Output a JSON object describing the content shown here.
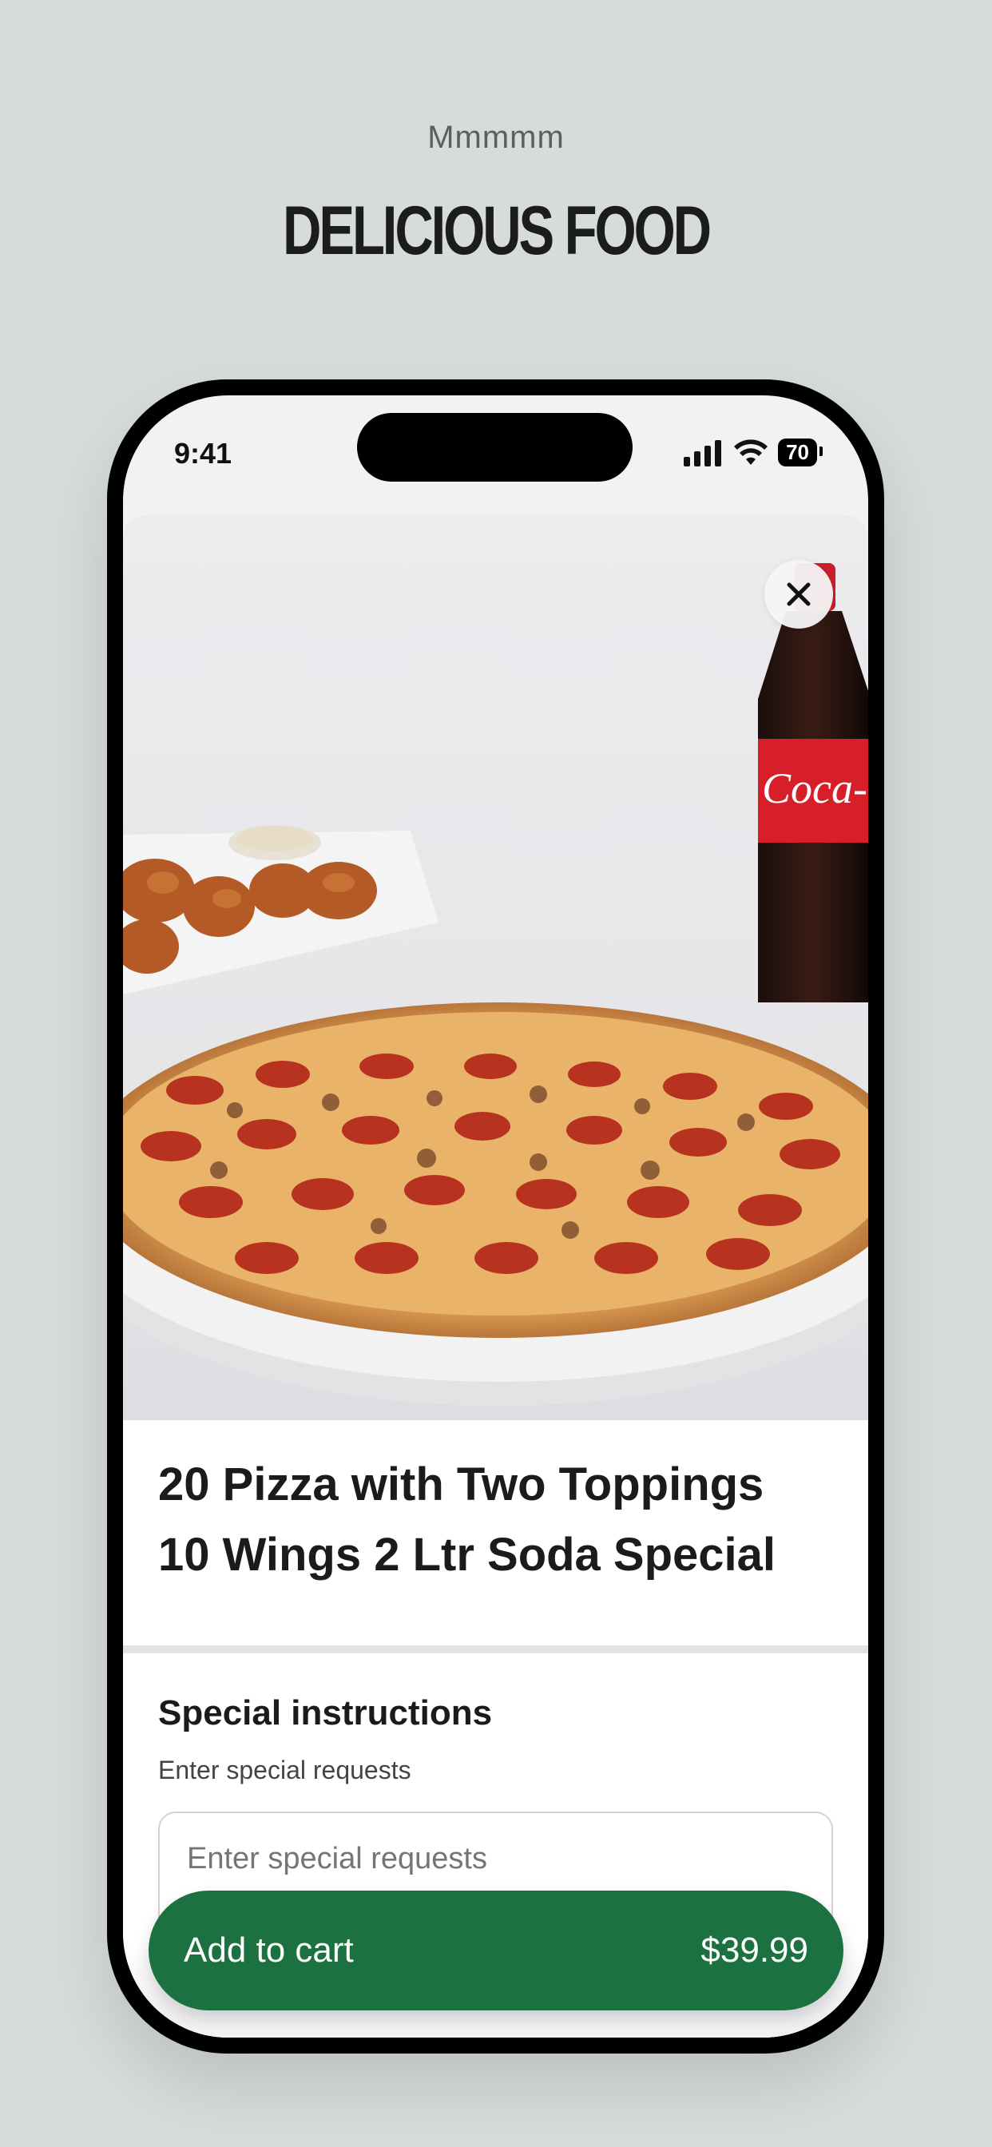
{
  "header": {
    "tagline": "Mmmmm",
    "headline": "DELICIOUS FOOD"
  },
  "status_bar": {
    "time": "9:41",
    "battery": "70"
  },
  "product": {
    "title_line1": "20 Pizza with Two Toppings",
    "title_line2": "10 Wings 2 Ltr Soda Special",
    "image_alt": "Pepperoni pizza with wings and Coca-Cola bottle",
    "bottle_label": "Coca-Cola"
  },
  "instructions": {
    "title": "Special instructions",
    "subtitle": "Enter special requests",
    "placeholder": "Enter special requests"
  },
  "cart": {
    "label": "Add to cart",
    "price": "$39.99",
    "color": "#1b7240"
  },
  "icons": {
    "close": "close-icon",
    "signal": "cellular-signal-icon",
    "wifi": "wifi-icon",
    "battery": "battery-icon"
  }
}
